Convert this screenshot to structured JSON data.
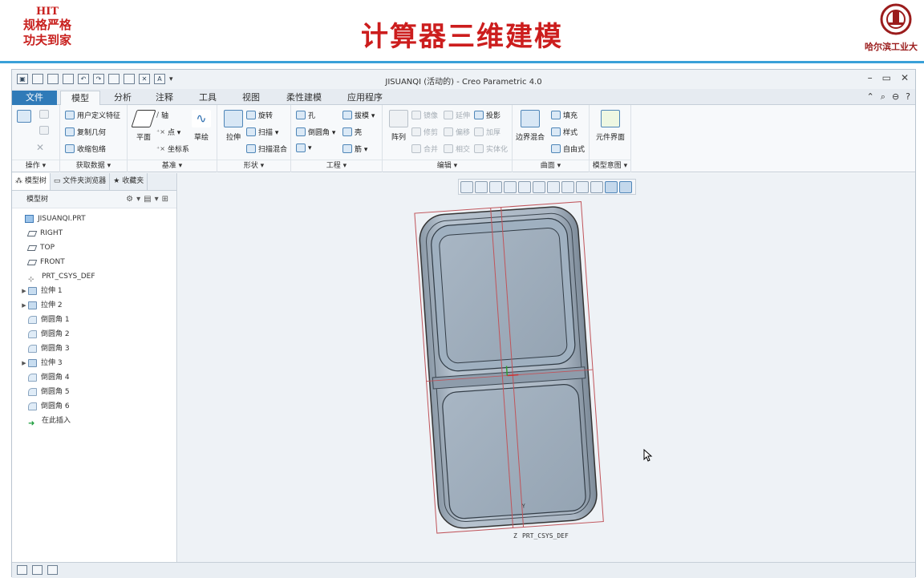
{
  "slide": {
    "motto_line1": "HIT",
    "motto_line2": "规格严格",
    "motto_line3": "功夫到家",
    "title": "计算器三维建模",
    "logo_caption": "哈尔滨工业大"
  },
  "window": {
    "title": "JISUANQI (活动的) - Creo Parametric 4.0",
    "controls": [
      "–",
      "▭",
      "✕"
    ]
  },
  "tabs": [
    {
      "label": "文件",
      "state": "file"
    },
    {
      "label": "模型",
      "state": "active"
    },
    {
      "label": "分析",
      "state": ""
    },
    {
      "label": "注释",
      "state": ""
    },
    {
      "label": "工具",
      "state": ""
    },
    {
      "label": "视图",
      "state": ""
    },
    {
      "label": "柔性建模",
      "state": ""
    },
    {
      "label": "应用程序",
      "state": ""
    }
  ],
  "ribbon": {
    "groups": {
      "operations": "操作 ▾",
      "get_data": "获取数据 ▾",
      "datum": "基准 ▾",
      "shapes": "形状 ▾",
      "engineering": "工程 ▾",
      "editing": "编辑 ▾",
      "surfaces": "曲面 ▾",
      "model_intent": "模型意图 ▾"
    },
    "get_data": {
      "user_feature": "用户定义特征",
      "copy_geometry": "复制几何",
      "shrinkwrap": "收缩包络"
    },
    "datum": {
      "plane": "平面",
      "axis": "轴",
      "point": "点 ▾",
      "csys": "坐标系",
      "sketch": "草绘"
    },
    "shapes": {
      "extrude": "拉伸",
      "revolve": "旋转",
      "sweep": "扫描 ▾",
      "swept_blend": "扫描混合"
    },
    "engineering": {
      "hole": "孔",
      "round": "倒圆角 ▾",
      "chamfer": "▾",
      "draft": "拔模 ▾",
      "shell": "壳",
      "rib": "筋 ▾"
    },
    "editing": {
      "pattern": "阵列",
      "mirror": "镜像",
      "extend": "延伸",
      "project": "投影",
      "trim": "修剪",
      "offset": "偏移",
      "thicken": "加厚",
      "merge": "合并",
      "intersect": "相交",
      "solidify": "实体化"
    },
    "surfaces": {
      "boundary_blend": "边界混合",
      "fill": "填充",
      "style": "样式",
      "freestyle": "自由式"
    },
    "model_intent": {
      "component_interface": "元件界面"
    }
  },
  "left_panel": {
    "tabs": [
      "模型树",
      "文件夹浏览器",
      "收藏夹"
    ],
    "header": "模型树",
    "tree": [
      {
        "label": "JISUANQI.PRT",
        "icon": "part-icon",
        "expand": ""
      },
      {
        "label": "RIGHT",
        "icon": "plane-icon",
        "expand": ""
      },
      {
        "label": "TOP",
        "icon": "plane-icon",
        "expand": ""
      },
      {
        "label": "FRONT",
        "icon": "plane-icon",
        "expand": ""
      },
      {
        "label": "PRT_CSYS_DEF",
        "icon": "csys-icon",
        "expand": ""
      },
      {
        "label": "拉伸 1",
        "icon": "extrude-icon",
        "expand": "▶"
      },
      {
        "label": "拉伸 2",
        "icon": "extrude-icon",
        "expand": "▶"
      },
      {
        "label": "倒圆角 1",
        "icon": "round-icon",
        "expand": ""
      },
      {
        "label": "倒圆角 2",
        "icon": "round-icon",
        "expand": ""
      },
      {
        "label": "倒圆角 3",
        "icon": "round-icon",
        "expand": ""
      },
      {
        "label": "拉伸 3",
        "icon": "extrude-icon",
        "expand": "▶"
      },
      {
        "label": "倒圆角 4",
        "icon": "round-icon",
        "expand": ""
      },
      {
        "label": "倒圆角 5",
        "icon": "round-icon",
        "expand": ""
      },
      {
        "label": "倒圆角 6",
        "icon": "round-icon",
        "expand": ""
      },
      {
        "label": "在此插入",
        "icon": "insert-here-icon",
        "expand": ""
      }
    ]
  },
  "graphics": {
    "csys_label": "PRT_CSYS_DEF",
    "axis_y": "Y",
    "axis_z": "Z"
  }
}
